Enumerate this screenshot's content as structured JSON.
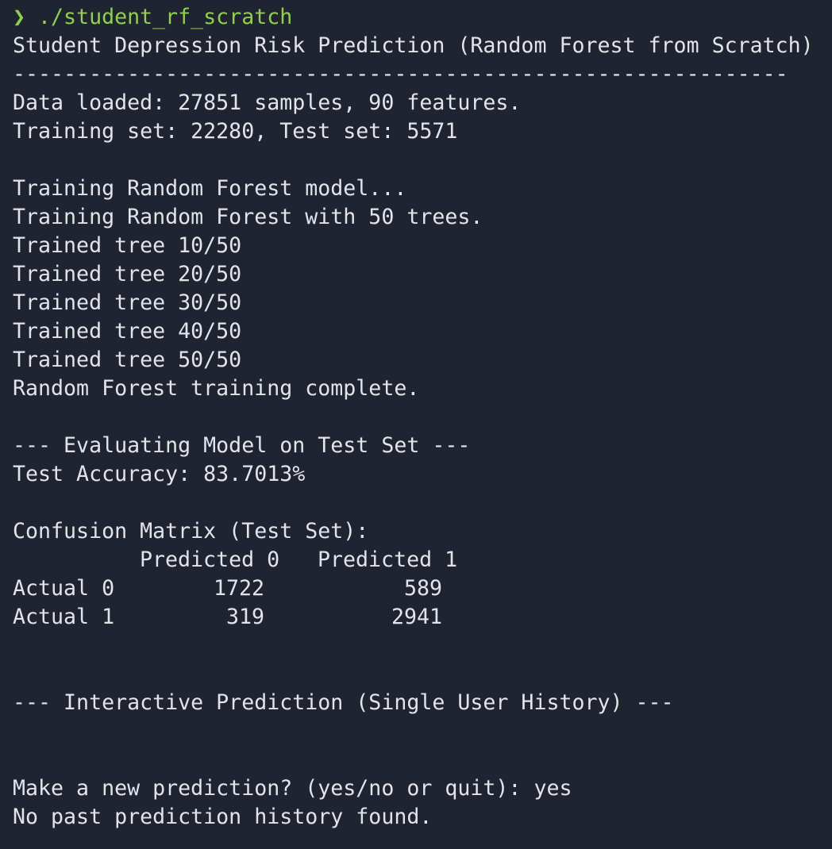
{
  "prompt": {
    "symbol": "❯",
    "command": "./student_rf_scratch"
  },
  "output": {
    "title": "Student Depression Risk Prediction (Random Forest from Scratch)",
    "separator": "-------------------------------------------------------------",
    "data_loaded": "Data loaded: 27851 samples, 90 features.",
    "split": "Training set: 22280, Test set: 5571",
    "training_start": "Training Random Forest model...",
    "training_trees": "Training Random Forest with 50 trees.",
    "trained_trees": [
      "Trained tree 10/50",
      "Trained tree 20/50",
      "Trained tree 30/50",
      "Trained tree 40/50",
      "Trained tree 50/50"
    ],
    "training_complete": "Random Forest training complete.",
    "eval_header": "--- Evaluating Model on Test Set ---",
    "accuracy": "Test Accuracy: 83.7013%",
    "confusion_title": "Confusion Matrix (Test Set):",
    "confusion": {
      "headers": [
        "Predicted 0",
        "Predicted 1"
      ],
      "rows": [
        {
          "label": "Actual 0",
          "values": [
            "1722",
            "589"
          ]
        },
        {
          "label": "Actual 1",
          "values": [
            "319",
            "2941"
          ]
        }
      ]
    },
    "interactive_header": "--- Interactive Prediction (Single User History) ---",
    "question": "Make a new prediction? (yes/no or quit): yes",
    "history": "No past prediction history found."
  }
}
